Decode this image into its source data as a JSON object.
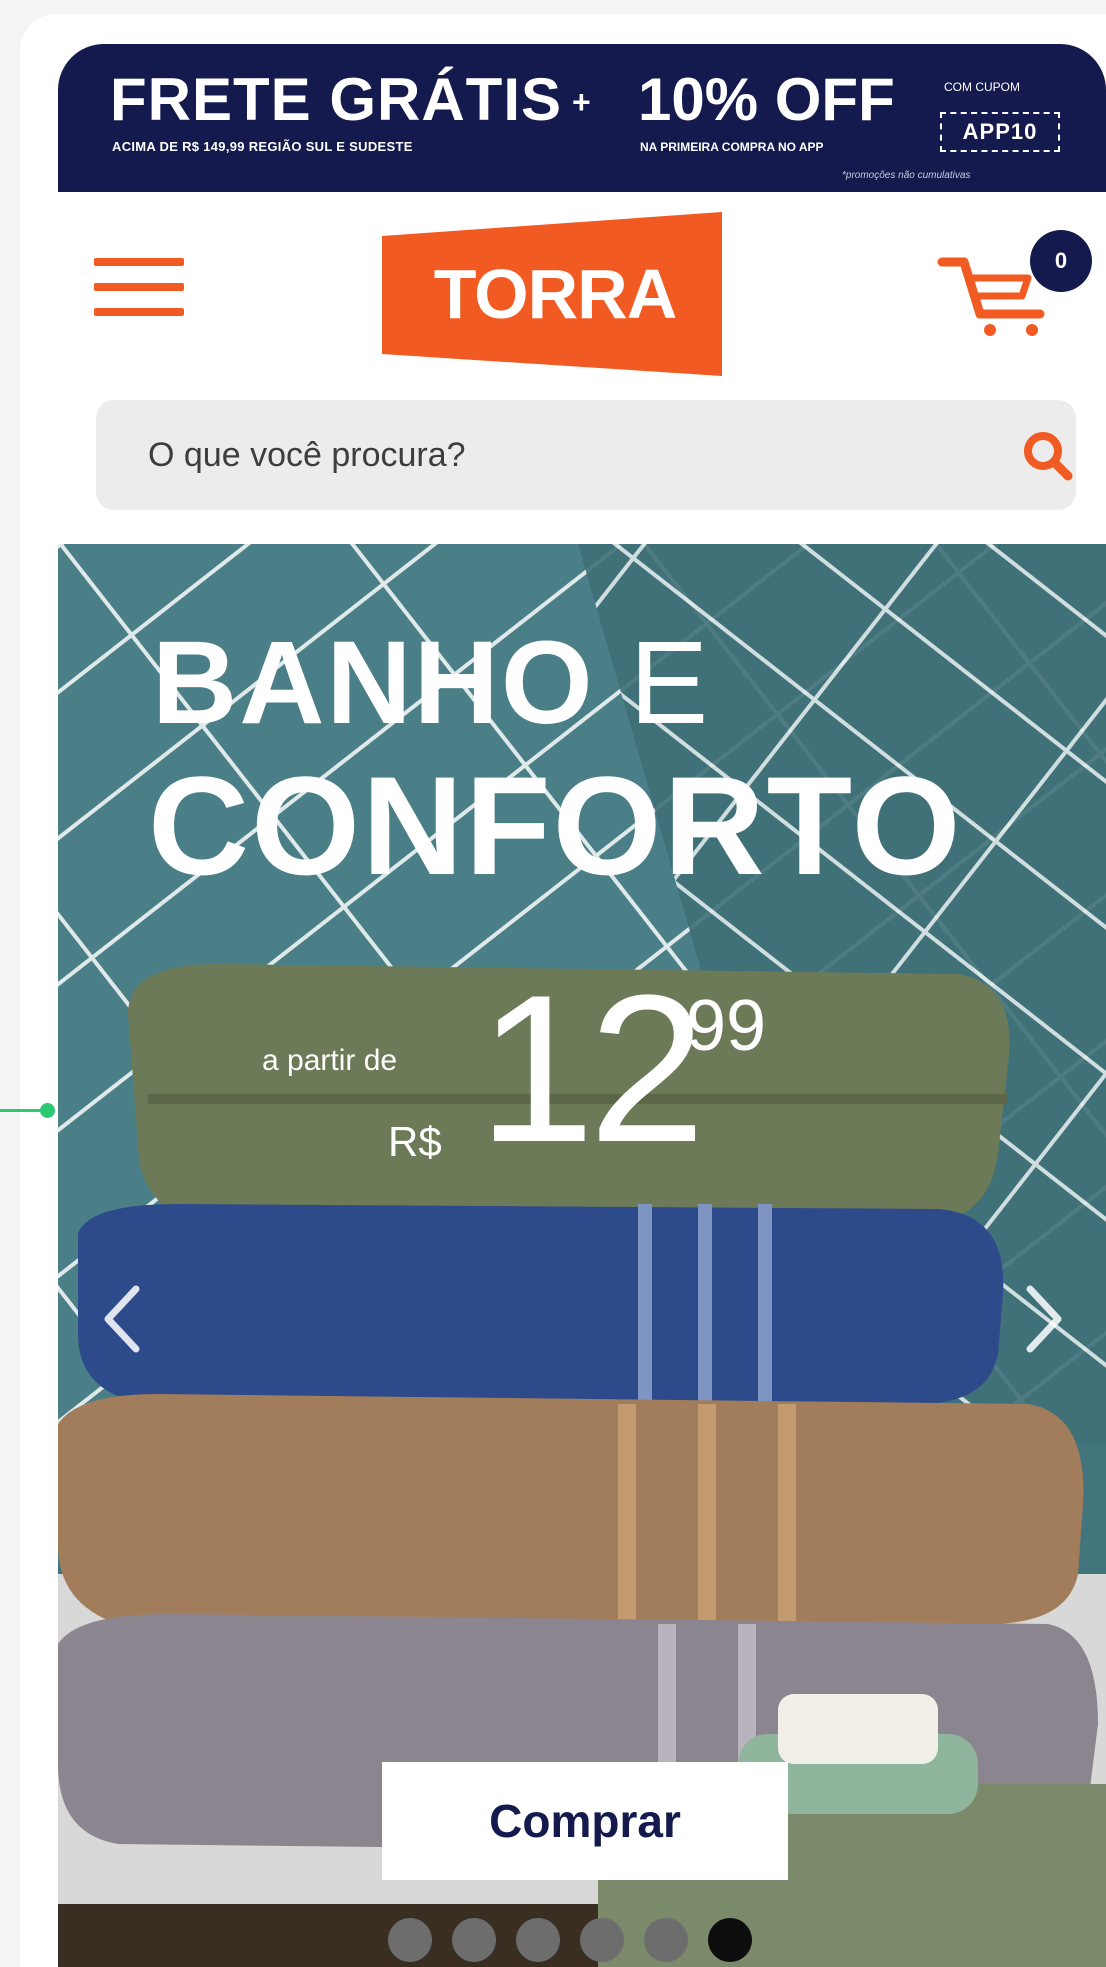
{
  "promo": {
    "frete_title": "FRETE GRÁTIS",
    "frete_sub": "ACIMA DE R$ 149,99 REGIÃO SUL E SUDESTE",
    "plus": "+",
    "off_title": "10% OFF",
    "off_sub": "NA PRIMEIRA COMPRA NO APP",
    "cupom_label": "COM CUPOM",
    "cupom_code": "APP10",
    "note": "*promoções não cumulativas"
  },
  "header": {
    "logo": "TORRA",
    "cart_count": "0",
    "menu_icon": "hamburger-icon",
    "cart_icon": "cart-icon"
  },
  "search": {
    "placeholder": "O que você procura?",
    "value": "",
    "icon": "search-icon"
  },
  "hero": {
    "title_bold": "BANHO",
    "title_thin": "E",
    "title_line2": "CONFORTO",
    "price_prefix": "a partir de",
    "price_currency": "R$",
    "price_main": "12",
    "price_cents": ",99",
    "buy_label": "Comprar",
    "slides_total": 6,
    "active_slide": 6
  },
  "colors": {
    "brand_orange": "#f15a22",
    "navy": "#141a4d",
    "hero_bg": "#42747c"
  }
}
